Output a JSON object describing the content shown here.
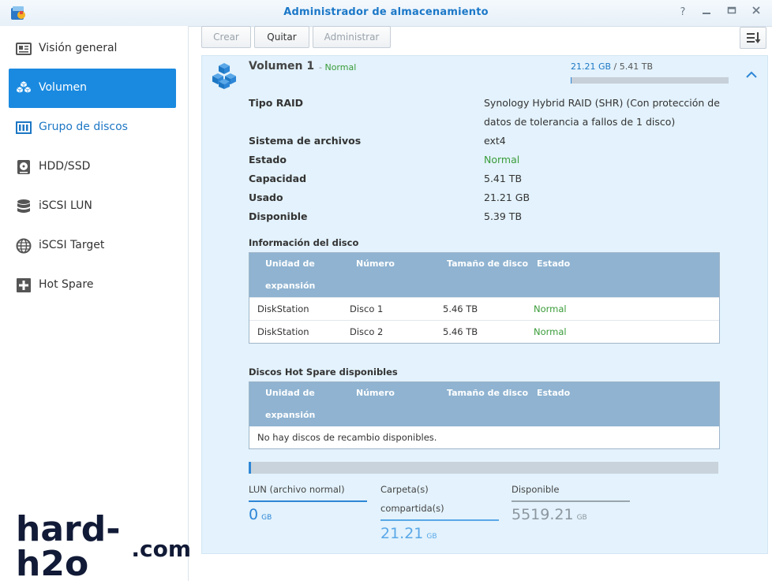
{
  "window": {
    "title": "Administrador de almacenamiento"
  },
  "sidebar": {
    "items": [
      {
        "label": "Visión general",
        "icon": "overview-icon"
      },
      {
        "label": "Volumen",
        "icon": "volume-cubes-icon"
      },
      {
        "label": "Grupo de discos",
        "icon": "disk-group-icon"
      },
      {
        "label": "HDD/SSD",
        "icon": "hdd-icon"
      },
      {
        "label": "iSCSI LUN",
        "icon": "database-icon"
      },
      {
        "label": "iSCSI Target",
        "icon": "globe-icon"
      },
      {
        "label": "Hot Spare",
        "icon": "plus-box-icon"
      }
    ]
  },
  "toolbar": {
    "create": "Crear",
    "remove": "Quitar",
    "manage": "Administrar"
  },
  "volume": {
    "name": "Volumen 1",
    "status": "Normal",
    "used": "21.21 GB",
    "separator": " / ",
    "total": "5.41 TB",
    "usage_fraction": 0.004,
    "properties": [
      {
        "label": "Tipo RAID",
        "value": "Synology Hybrid RAID (SHR) (Con protección de datos de tolerancia a fallos de 1 disco)"
      },
      {
        "label": "Sistema de archivos",
        "value": "ext4"
      },
      {
        "label": "Estado",
        "value": "Normal"
      },
      {
        "label": "Capacidad",
        "value": "5.41 TB"
      },
      {
        "label": "Usado",
        "value": "21.21 GB"
      },
      {
        "label": "Disponible",
        "value": "5.39 TB"
      }
    ]
  },
  "disk_info": {
    "title": "Información del disco",
    "headers": [
      "Unidad de expansión",
      "Número",
      "Tamaño de disco",
      "Estado"
    ],
    "rows": [
      [
        "DiskStation",
        "Disco 1",
        "5.46 TB",
        "Normal"
      ],
      [
        "DiskStation",
        "Disco 2",
        "5.46 TB",
        "Normal"
      ]
    ]
  },
  "hot_spare": {
    "title": "Discos Hot Spare disponibles",
    "headers": [
      "Unidad de expansión",
      "Número",
      "Tamaño de disco",
      "Estado"
    ],
    "empty": "No hay discos de recambio disponibles."
  },
  "capacity": {
    "stats": [
      {
        "label": "LUN (archivo normal)",
        "value": "0",
        "unit": "GB"
      },
      {
        "label": "Carpeta(s) compartida(s)",
        "value": "21.21",
        "unit": "GB"
      },
      {
        "label": "Disponible",
        "value": "5519.21",
        "unit": "GB"
      }
    ]
  },
  "watermark": {
    "line1": "hard-h2o",
    "line2": ".com"
  },
  "colors": {
    "accent": "#1a8ae0",
    "panel": "#e3f2fc",
    "green": "#3a9c3a",
    "table_header": "#8fb3d1"
  }
}
